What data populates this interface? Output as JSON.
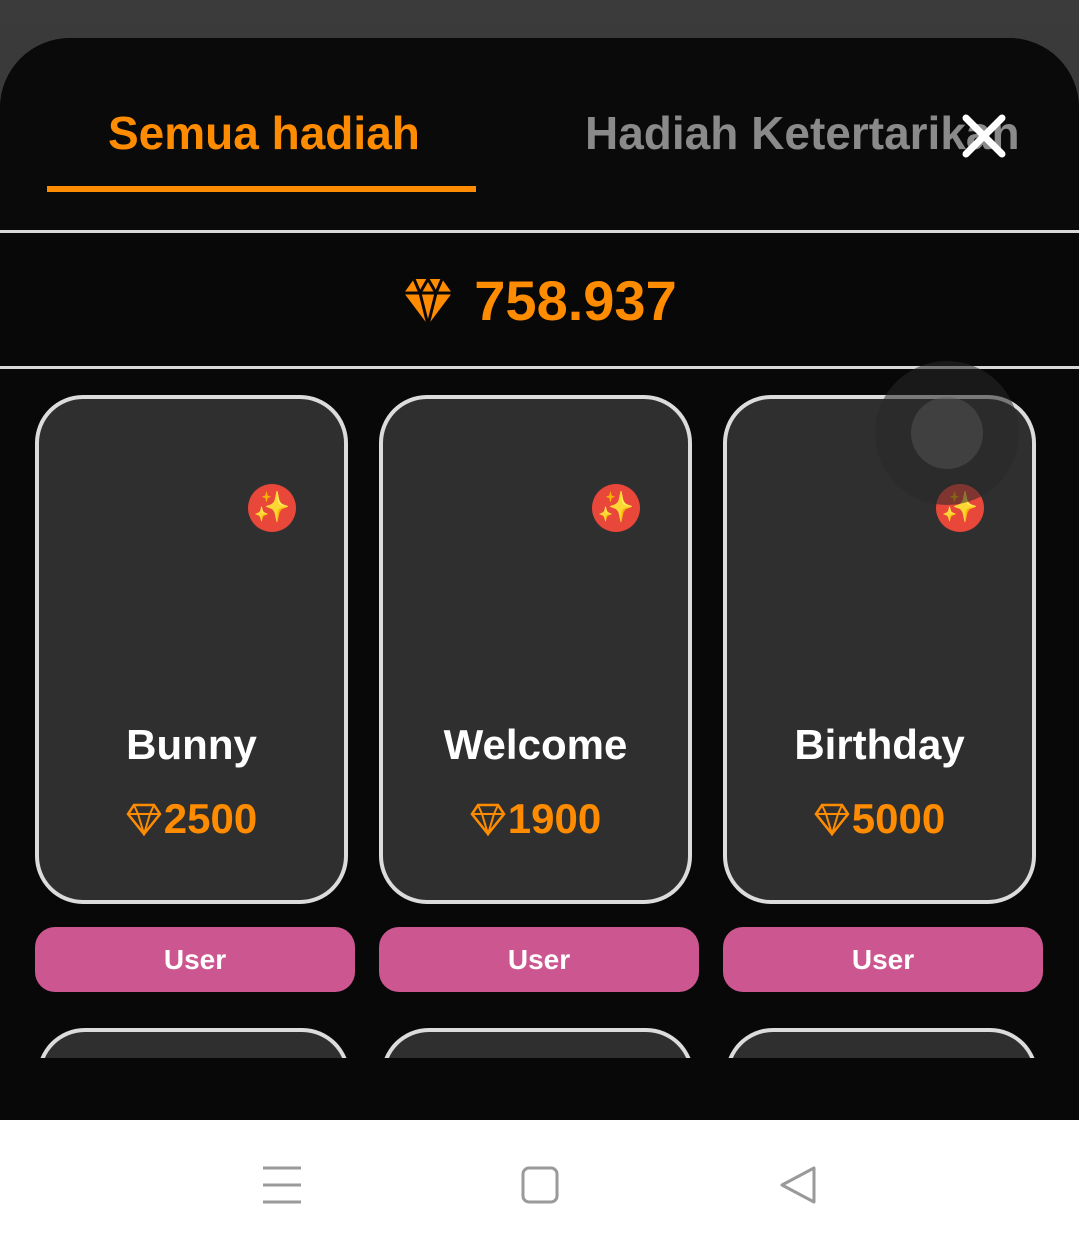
{
  "tabs": {
    "all_gifts": "Semua hadiah",
    "interest_gifts": "Hadiah Ketertarikan"
  },
  "balance": {
    "value": "758.937",
    "icon": "diamond-icon"
  },
  "gifts": [
    {
      "name": "Bunny",
      "price": "2500",
      "button": "User"
    },
    {
      "name": "Welcome",
      "price": "1900",
      "button": "User"
    },
    {
      "name": "Birthday",
      "price": "5000",
      "button": "User"
    }
  ],
  "badge_glyph": "✨",
  "colors": {
    "accent": "#ff8c00",
    "button": "#cc5690",
    "badge": "#e8473a",
    "card": "#2f2f2f"
  },
  "icons": {
    "close": "close-icon",
    "menu": "menu-icon",
    "home": "home-icon",
    "back": "back-icon"
  }
}
